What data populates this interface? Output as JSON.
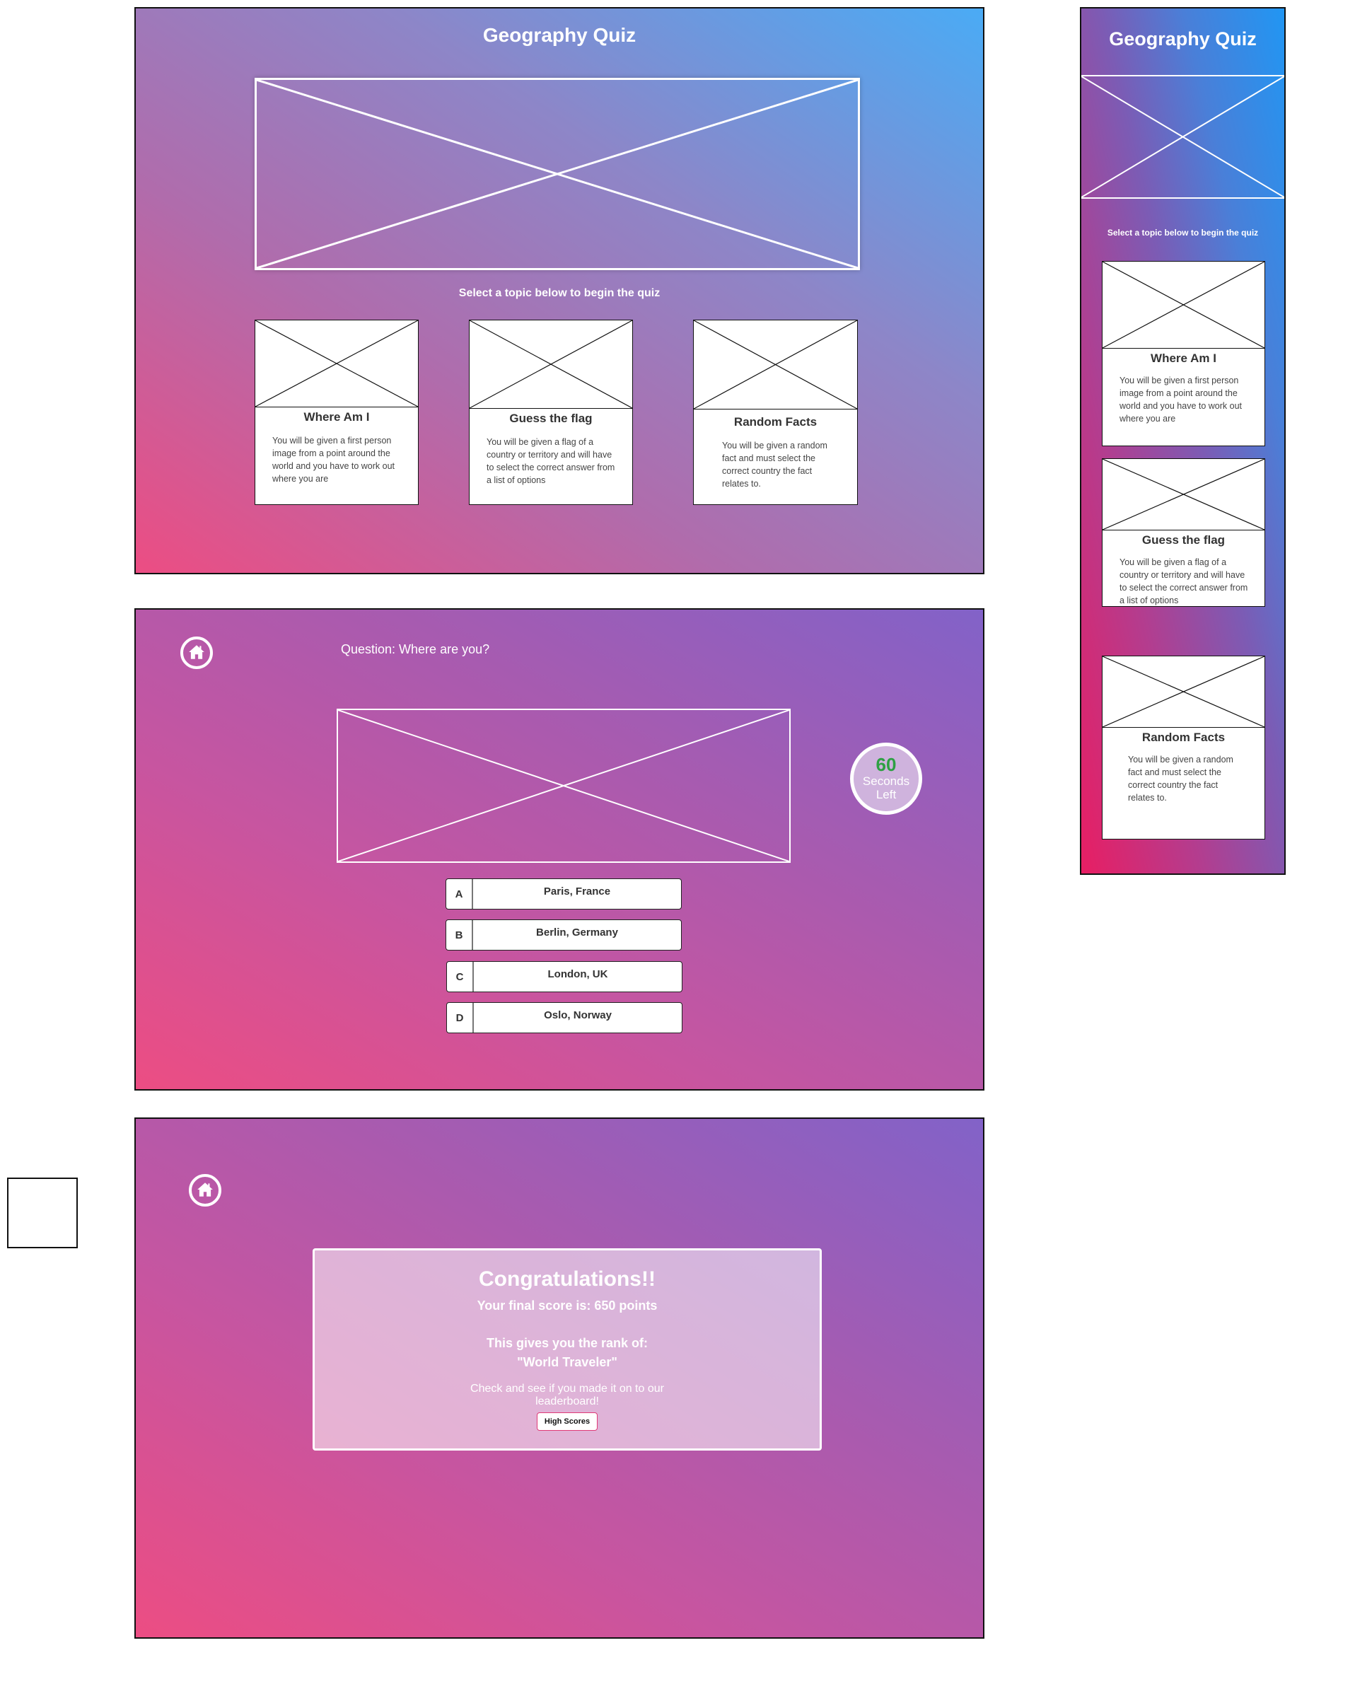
{
  "app_title": "Geography Quiz",
  "home_screen": {
    "title": "Geography Quiz",
    "hero_image": "image-placeholder",
    "select_prompt": "Select a topic below to begin the quiz",
    "topics": [
      {
        "title": "Where Am I",
        "description": "You will be given a first person image from a point around the world and you have to work out where you are"
      },
      {
        "title": "Guess the flag",
        "description": "You will be given a flag of a country or territory and will have to select the correct answer from a list of options"
      },
      {
        "title": "Random Facts",
        "description": "You will be given a random fact and must select the correct country the fact relates to."
      }
    ]
  },
  "question_screen": {
    "home_icon": "home-icon",
    "question": "Question:  Where are you?",
    "timer": {
      "value": "60",
      "label_line1": "Seconds",
      "label_line2": "Left",
      "value_color": "#2ea043"
    },
    "answers": [
      {
        "letter": "A",
        "text": "Paris, France"
      },
      {
        "letter": "B",
        "text": "Berlin, Germany"
      },
      {
        "letter": "C",
        "text": "London, UK"
      },
      {
        "letter": "D",
        "text": "Oslo, Norway"
      }
    ]
  },
  "result_screen": {
    "home_icon": "home-icon",
    "heading": "Congratulations!!",
    "score_text": "Your final score is: 650 points",
    "rank_intro": "This gives you the rank of:",
    "rank_name": "\"World Traveler\"",
    "leaderboard_prompt": "Check and see if you made it on to our leaderboard!",
    "high_scores_button": "High Scores"
  },
  "mobile_home_screen": {
    "title": "Geography Quiz",
    "select_prompt": "Select a topic below to begin the quiz",
    "topics": [
      {
        "title": "Where Am I",
        "description": "You will be given a first person image from a point around the world and you have to work out where you are"
      },
      {
        "title": "Guess the flag",
        "description": "You will be given a flag of a country or territory and will have to select the correct answer from a list of options"
      },
      {
        "title": "Random Facts",
        "description": "You will be given a random fact and must select the correct country the fact relates to."
      }
    ]
  },
  "colors": {
    "accent_pink": "#ec4d83",
    "accent_blue": "#2196f3",
    "accent_purple": "#8262c8",
    "timer_green": "#2ea043",
    "button_border": "#e03a77"
  }
}
